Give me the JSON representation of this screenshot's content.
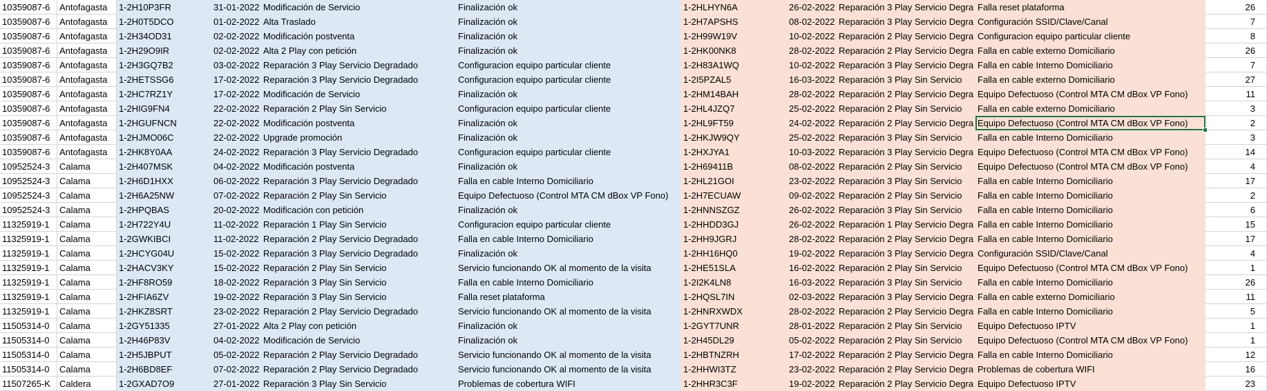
{
  "selected_cell": {
    "row": 8,
    "col": 9
  },
  "rows": [
    [
      "10359087-6",
      "Antofagasta",
      "1-2H10P3FR",
      "31-01-2022",
      "Modificación de Servicio",
      "Finalización ok",
      "1-2HLHYN6A",
      "26-02-2022",
      "Reparación 3 Play Servicio Degra",
      "Falla reset plataforma",
      "26"
    ],
    [
      "10359087-6",
      "Antofagasta",
      "1-2H0T5DCO",
      "01-02-2022",
      "Alta Traslado",
      "Finalización ok",
      "1-2H7APSHS",
      "08-02-2022",
      "Reparación 3 Play Servicio Degra",
      "Configuración SSID/Clave/Canal",
      "7"
    ],
    [
      "10359087-6",
      "Antofagasta",
      "1-2H34OD31",
      "02-02-2022",
      "Modificación postventa",
      "Finalización ok",
      "1-2H99W19V",
      "10-02-2022",
      "Reparación 2 Play Servicio Degra",
      "Configuracion equipo particular cliente",
      "8"
    ],
    [
      "10359087-6",
      "Antofagasta",
      "1-2H29O9IR",
      "02-02-2022",
      "Alta 2 Play con petición",
      "Finalización ok",
      "1-2HK00NK8",
      "28-02-2022",
      "Reparación 2 Play Servicio Degra",
      "Falla en cable externo Domiciliario",
      "26"
    ],
    [
      "10359087-6",
      "Antofagasta",
      "1-2H3GQ7B2",
      "03-02-2022",
      "Reparación 3 Play Servicio Degradado",
      "Configuracion equipo particular cliente",
      "1-2H83A1WQ",
      "10-02-2022",
      "Reparación 3 Play Servicio Degra",
      "Falla en cable Interno Domiciliario",
      "7"
    ],
    [
      "10359087-6",
      "Antofagasta",
      "1-2HETSSG6",
      "17-02-2022",
      "Reparación 3 Play Servicio Degradado",
      "Configuracion equipo particular cliente",
      "1-2I5PZAL5",
      "16-03-2022",
      "Reparación 3 Play Sin Servicio",
      "Falla en cable externo Domiciliario",
      "27"
    ],
    [
      "10359087-6",
      "Antofagasta",
      "1-2HC7RZ1Y",
      "17-02-2022",
      "Modificación de Servicio",
      "Finalización ok",
      "1-2HM14BAH",
      "28-02-2022",
      "Reparación 2 Play Servicio Degra",
      "Equipo Defectuoso (Control MTA CM dBox VP Fono)",
      "11"
    ],
    [
      "10359087-6",
      "Antofagasta",
      "1-2HIG9FN4",
      "22-02-2022",
      "Reparación 2 Play Sin Servicio",
      "Configuracion equipo particular cliente",
      "1-2HL4JZQ7",
      "25-02-2022",
      "Reparación 2 Play Sin Servicio",
      "Falla en cable externo Domiciliario",
      "3"
    ],
    [
      "10359087-6",
      "Antofagasta",
      "1-2HGUFNCN",
      "22-02-2022",
      "Modificación postventa",
      "Finalización ok",
      "1-2HL9FT59",
      "24-02-2022",
      "Reparación 2 Play Servicio Degra",
      "Equipo Defectuoso (Control MTA CM dBox VP Fono)",
      "2"
    ],
    [
      "10359087-6",
      "Antofagasta",
      "1-2HJMO06C",
      "22-02-2022",
      "Upgrade promoción",
      "Finalización ok",
      "1-2HKJW9QY",
      "25-02-2022",
      "Reparación 3 Play Sin Servicio",
      "Falla en cable Interno Domiciliario",
      "3"
    ],
    [
      "10359087-6",
      "Antofagasta",
      "1-2HK8Y0AA",
      "24-02-2022",
      "Reparación 3 Play Servicio Degradado",
      "Configuracion equipo particular cliente",
      "1-2HXJYA1",
      "10-03-2022",
      "Reparación 3 Play Servicio Degra",
      "Equipo Defectuoso (Control MTA CM dBox VP Fono)",
      "14"
    ],
    [
      "10952524-3",
      "Calama",
      "1-2H407MSK",
      "04-02-2022",
      "Modificación postventa",
      "Finalización ok",
      "1-2H69411B",
      "08-02-2022",
      "Reparación 2 Play Sin Servicio",
      "Equipo Defectuoso (Control MTA CM dBox VP Fono)",
      "4"
    ],
    [
      "10952524-3",
      "Calama",
      "1-2H6D1HXX",
      "06-02-2022",
      "Reparación 3 Play Servicio Degradado",
      "Falla en cable Interno Domiciliario",
      "1-2HL21GOI",
      "23-02-2022",
      "Reparación 3 Play Sin Servicio",
      "Falla en cable Interno Domiciliario",
      "17"
    ],
    [
      "10952524-3",
      "Calama",
      "1-2H6A25NW",
      "07-02-2022",
      "Reparación 2 Play Sin Servicio",
      "Equipo Defectuoso (Control MTA CM dBox VP Fono)",
      "1-2H7ECUAW",
      "09-02-2022",
      "Reparación 2 Play Sin Servicio",
      "Falla en cable Interno Domiciliario",
      "2"
    ],
    [
      "10952524-3",
      "Calama",
      "1-2HPQBAS",
      "20-02-2022",
      "Modificación con petición",
      "Finalización ok",
      "1-2HNNSZGZ",
      "26-02-2022",
      "Reparación 3 Play Sin Servicio",
      "Falla en cable Interno Domiciliario",
      "6"
    ],
    [
      "11325919-1",
      "Calama",
      "1-2H722Y4U",
      "11-02-2022",
      "Reparación 1 Play Sin Servicio",
      "Configuracion equipo particular cliente",
      "1-2HHDD3GJ",
      "26-02-2022",
      "Reparación 1 Play Servicio Degra",
      "Falla en cable Interno Domiciliario",
      "15"
    ],
    [
      "11325919-1",
      "Calama",
      "1-2GWKIBCI",
      "11-02-2022",
      "Reparación 2 Play Servicio Degradado",
      "Falla en cable Interno Domiciliario",
      "1-2HH9JGRJ",
      "28-02-2022",
      "Reparación 2 Play Servicio Degra",
      "Falla en cable Interno Domiciliario",
      "17"
    ],
    [
      "11325919-1",
      "Calama",
      "1-2HCYG04U",
      "15-02-2022",
      "Reparación 3 Play Servicio Degradado",
      "Finalización ok",
      "1-2HH16HQ0",
      "19-02-2022",
      "Reparación 3 Play Servicio Degra",
      "Configuración SSID/Clave/Canal",
      "4"
    ],
    [
      "11325919-1",
      "Calama",
      "1-2HACV3KY",
      "15-02-2022",
      "Reparación 2 Play Sin Servicio",
      "Servicio funcionando OK al momento de la visita",
      "1-2HE51SLA",
      "16-02-2022",
      "Reparación 2 Play Sin Servicio",
      "Equipo Defectuoso (Control MTA CM dBox VP Fono)",
      "1"
    ],
    [
      "11325919-1",
      "Calama",
      "1-2HF8RO59",
      "18-02-2022",
      "Reparación 3 Play Sin Servicio",
      "Falla en cable Interno Domiciliario",
      "1-2I2K4LN8",
      "16-03-2022",
      "Reparación 3 Play Sin Servicio",
      "Falla en cable Interno Domiciliario",
      "26"
    ],
    [
      "11325919-1",
      "Calama",
      "1-2HFIA6ZV",
      "19-02-2022",
      "Reparación 3 Play Sin Servicio",
      "Falla reset plataforma",
      "1-2HQSL7IN",
      "02-03-2022",
      "Reparación 3 Play Servicio Degra",
      "Falla en cable externo Domiciliario",
      "11"
    ],
    [
      "11325919-1",
      "Calama",
      "1-2HKZ8SRT",
      "23-02-2022",
      "Reparación 2 Play Servicio Degradado",
      "Servicio funcionando OK al momento de la visita",
      "1-2HNRXWDX",
      "28-02-2022",
      "Reparación 2 Play Servicio Degra",
      "Falla en cable Interno Domiciliario",
      "5"
    ],
    [
      "11505314-0",
      "Calama",
      "1-2GY51335",
      "27-01-2022",
      "Alta 2 Play con petición",
      "Finalización ok",
      "1-2GYT7UNR",
      "28-01-2022",
      "Reparación 2 Play Sin Servicio",
      "Equipo Defectuoso IPTV",
      "1"
    ],
    [
      "11505314-0",
      "Calama",
      "1-2H46P83V",
      "04-02-2022",
      "Modificación de Servicio",
      "Finalización ok",
      "1-2H45DL29",
      "05-02-2022",
      "Reparación 2 Play Sin Servicio",
      "Equipo Defectuoso (Control MTA CM dBox VP Fono)",
      "1"
    ],
    [
      "11505314-0",
      "Calama",
      "1-2H5JBPUT",
      "05-02-2022",
      "Reparación 2 Play Servicio Degradado",
      "Servicio funcionando OK al momento de la visita",
      "1-2HBTNZRH",
      "17-02-2022",
      "Reparación 2 Play Servicio Degra",
      "Falla en cable Interno Domiciliario",
      "12"
    ],
    [
      "11505314-0",
      "Calama",
      "1-2H6BD8EF",
      "07-02-2022",
      "Reparación 2 Play Servicio Degradado",
      "Servicio funcionando OK al momento de la visita",
      "1-2HHWI3TZ",
      "23-02-2022",
      "Reparación 2 Play Servicio Degra",
      "Problemas de cobertura WIFI",
      "16"
    ],
    [
      "11507265-K",
      "Caldera",
      "1-2GXAD7O9",
      "27-01-2022",
      "Reparación 3 Play Sin Servicio",
      "Problemas de cobertura WIFI",
      "1-2HHR3C3F",
      "19-02-2022",
      "Reparación 2 Play Servicio Degra",
      "Equipo Defectuoso IPTV",
      "23"
    ]
  ]
}
